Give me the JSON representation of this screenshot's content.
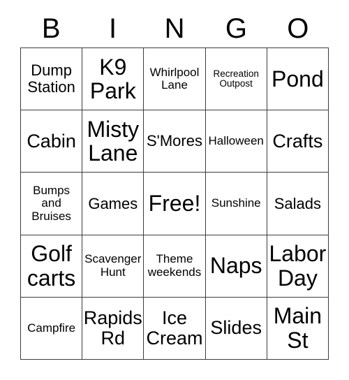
{
  "card": {
    "type": "bingo-card",
    "columns": 5,
    "rows": 5,
    "header": {
      "letters": [
        "B",
        "I",
        "N",
        "G",
        "O"
      ]
    },
    "free_space": {
      "label": "Free!",
      "row": 3,
      "column": 3
    },
    "cells": [
      [
        {
          "label": "Dump\nStation",
          "size": "m"
        },
        {
          "label": "K9\nPark",
          "size": "xl"
        },
        {
          "label": "Whirlpool\nLane",
          "size": "s"
        },
        {
          "label": "Recreation\nOutpost",
          "size": "xs"
        },
        {
          "label": "Pond",
          "size": "xl"
        }
      ],
      [
        {
          "label": "Cabin",
          "size": "l"
        },
        {
          "label": "Misty\nLane",
          "size": "xl"
        },
        {
          "label": "S'Mores",
          "size": "m"
        },
        {
          "label": "Halloween",
          "size": "s"
        },
        {
          "label": "Crafts",
          "size": "l"
        }
      ],
      [
        {
          "label": "Bumps\nand\nBruises",
          "size": "s"
        },
        {
          "label": "Games",
          "size": "m"
        },
        {
          "label": "Free!",
          "size": "xl"
        },
        {
          "label": "Sunshine",
          "size": "s"
        },
        {
          "label": "Salads",
          "size": "m"
        }
      ],
      [
        {
          "label": "Golf\ncarts",
          "size": "xl"
        },
        {
          "label": "Scavenger\nHunt",
          "size": "s"
        },
        {
          "label": "Theme\nweekends",
          "size": "s"
        },
        {
          "label": "Naps",
          "size": "xl"
        },
        {
          "label": "Labor\nDay",
          "size": "xl"
        }
      ],
      [
        {
          "label": "Campfire",
          "size": "s"
        },
        {
          "label": "Rapids\nRd",
          "size": "l"
        },
        {
          "label": "Ice\nCream",
          "size": "l"
        },
        {
          "label": "Slides",
          "size": "l"
        },
        {
          "label": "Main\nSt",
          "size": "xl"
        }
      ]
    ]
  },
  "style": {
    "background_color": "#ffffff",
    "text_color": "#000000",
    "grid_line_color": "#3c3c3c"
  }
}
